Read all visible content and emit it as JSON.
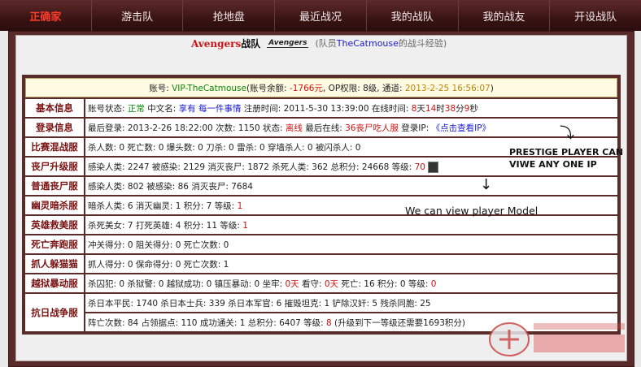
{
  "nav": {
    "brand": "正确家",
    "items": [
      "游击队",
      "抢地盘",
      "最近战况",
      "我的战队",
      "我的战友",
      "开设战队"
    ]
  },
  "team": {
    "name_en": "Avengers",
    "name_suffix": "战队",
    "logo_text": "Avengers",
    "sub_prefix": "(队员",
    "member": "TheCatmouse",
    "sub_suffix": "的战斗经验)"
  },
  "account": {
    "prefix": "账号: ",
    "id": "VIP-TheCatmouse",
    "balance_label": "(账号余额: ",
    "balance": "-1766元",
    "perm": ", OP权限: 8级, 通道: ",
    "date": "2013-2-25 16:56:07",
    "close": ")"
  },
  "rows": {
    "basic": {
      "label": "基本信息",
      "status_label": "账号状态: ",
      "status": "正常",
      "cn_label": " 中文名: ",
      "cn": "享有 每一件事情",
      "reg": " 注册时间: 2011-5-30 13:39:00 在线时间: ",
      "days": "8",
      "d": "天",
      "hours": "14",
      "h": "时",
      "mins": "38",
      "m": "分",
      "secs": "9",
      "s": "秒"
    },
    "login": {
      "label": "登录信息",
      "text": "最后登录: 2013-2-26 18:22:00 次数: 1150 状态: ",
      "state": "离线",
      "last": " 最后在线: ",
      "server": "36丧尸吃人服",
      "ip_label": " 登录IP: ",
      "ip_link": "《点击查看IP》"
    },
    "mix": {
      "label": "比赛混战服",
      "text": "杀人数: 0 死亡数: 0 爆头数: 0 刀杀: 0 雷杀: 0 穿墙杀人: 0 被闪杀人: 0"
    },
    "zombie_up": {
      "label": "丧尸升级服",
      "text": "感染人类: 2247 被感染: 2129 消灭丧尸: 1872 杀死人类: 362 总积分: 24668 等级: ",
      "level": "70"
    },
    "zombie": {
      "label": "普通丧尸服",
      "text": "感染人类: 802 被感染: 86 消灭丧尸: 7684"
    },
    "ghost": {
      "label": "幽灵暗杀服",
      "text": "暗杀人类: 6 消灭幽灵: 1 积分: 7 等级: ",
      "level": "1"
    },
    "hero": {
      "label": "英雄救美服",
      "text": "杀死美女: 7 打死英雄: 4 积分: 11 等级: ",
      "level": "1"
    },
    "death": {
      "label": "死亡奔跑服",
      "text": "冲关得分: 0 阻关得分: 0 死亡次数: 0"
    },
    "cat": {
      "label": "抓人躲猫猫",
      "text": "抓人得分: 0 保命得分: 0 死亡次数: 1"
    },
    "jail": {
      "label": "越狱暴动服",
      "text": "杀囚犯: 0 杀狱警: 0 越狱成功: 0 镇压暴动: 0 坐牢: ",
      "t1": "0天",
      "t2": " 看守: ",
      "t3": "0天",
      "t4": " 死亡: 16 积分: 0 等级: ",
      "level": "0"
    },
    "war": {
      "label": "抗日战争服",
      "line1": "杀日本平民: 1740 杀日本士兵: 339 杀日本军官: 6 摧毁坦克: 1 铲除汉奸: 5 残杀同胞: 25",
      "line2a": "阵亡次数: 84 占领据点: 110 成功通关: 1 总积分: 6407 等级: ",
      "level": "8",
      "line2b": " (升级到下一等级还需要1693积分)"
    }
  },
  "annotations": {
    "prestige_line1": "PRESTIGE PLAYER CAN",
    "prestige_line2": "VIWE ANY ONE IP",
    "model": "We can view player Model"
  },
  "colors": {
    "nav_bg": "#3a1414",
    "frame": "#5a2b2b",
    "label": "#7a1111",
    "green": "#0a8a0a",
    "red": "#d01010",
    "blue": "#1a1ad0"
  }
}
